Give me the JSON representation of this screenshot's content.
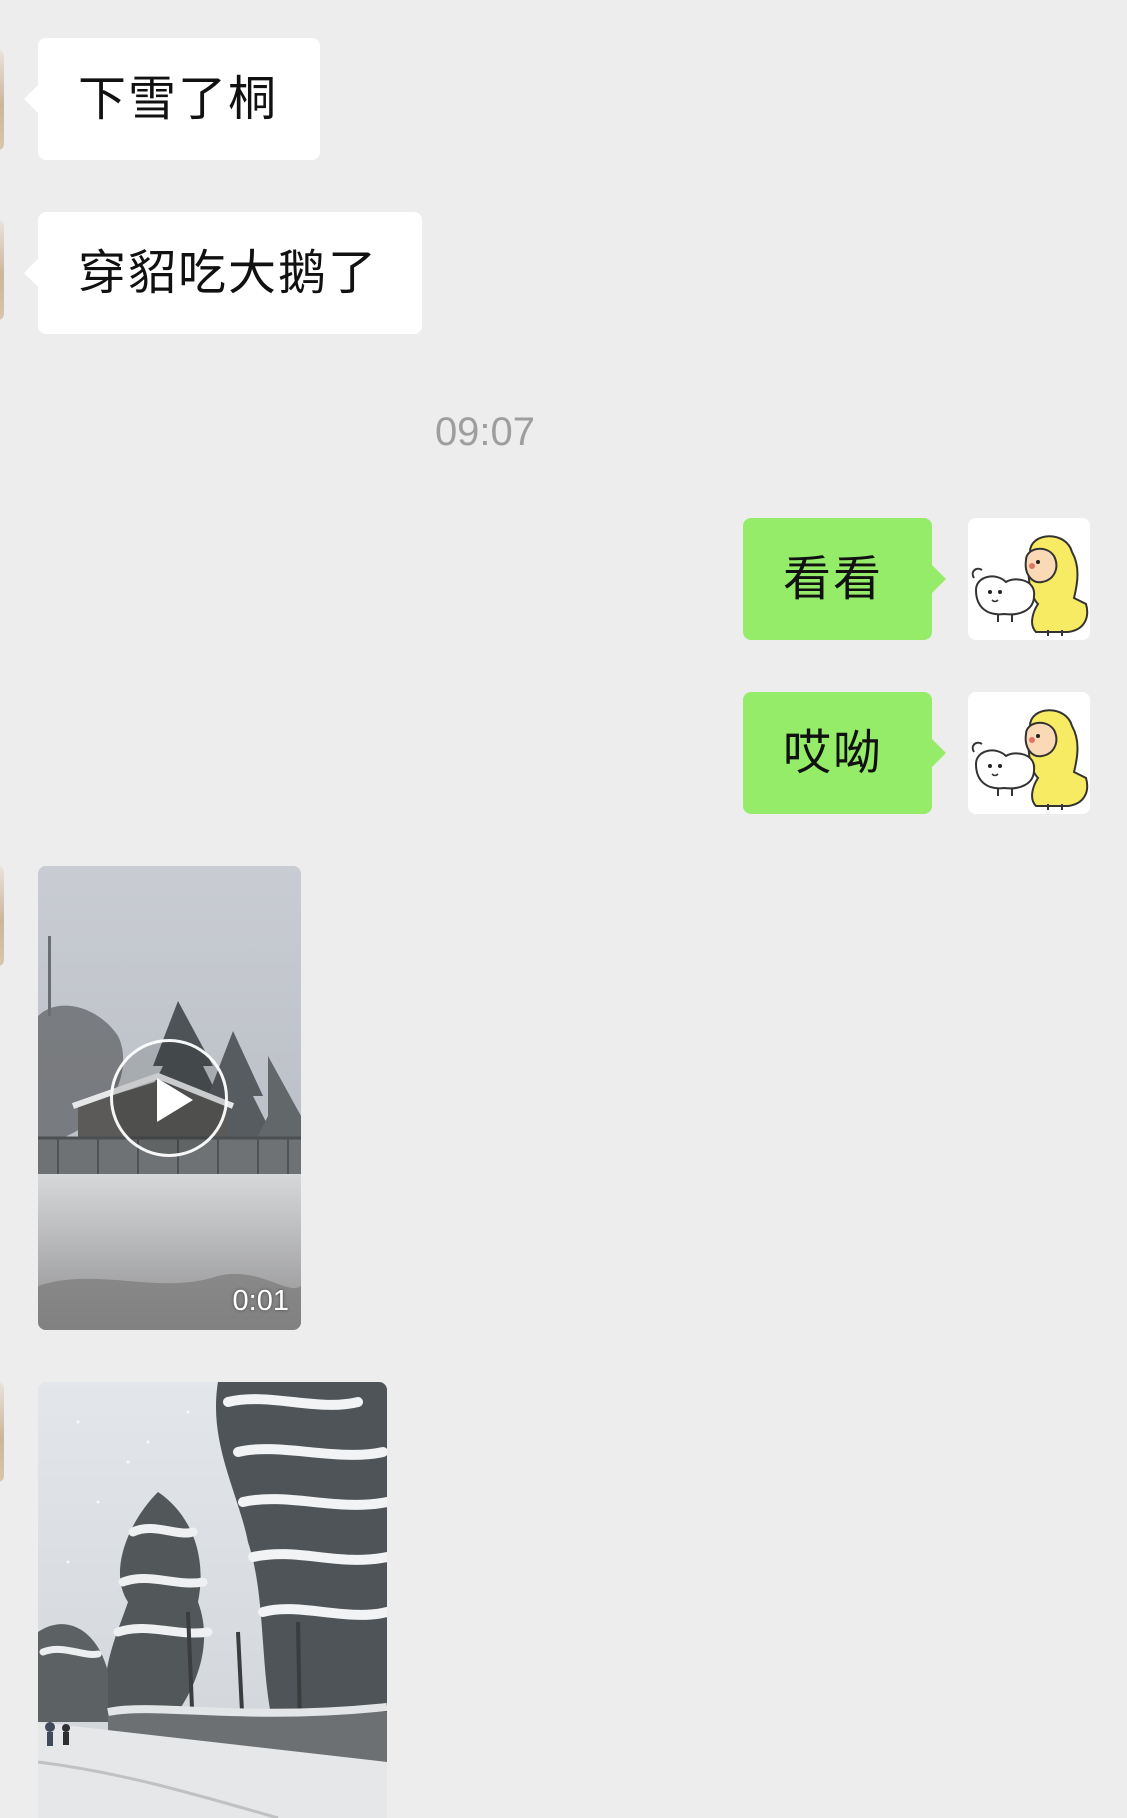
{
  "messages": {
    "in_1": "下雪了桐",
    "in_2": "穿貂吃大鹅了",
    "out_1": "看看",
    "out_2": "哎呦"
  },
  "timestamp": "09:07",
  "video": {
    "duration": "0:01"
  },
  "colors": {
    "background": "#EDEDED",
    "incoming_bubble": "#FFFFFF",
    "outgoing_bubble": "#95EC69",
    "timestamp_text": "#9E9E9E"
  },
  "icons": {
    "play": "play-icon",
    "avatar": "cartoon-avatar"
  }
}
